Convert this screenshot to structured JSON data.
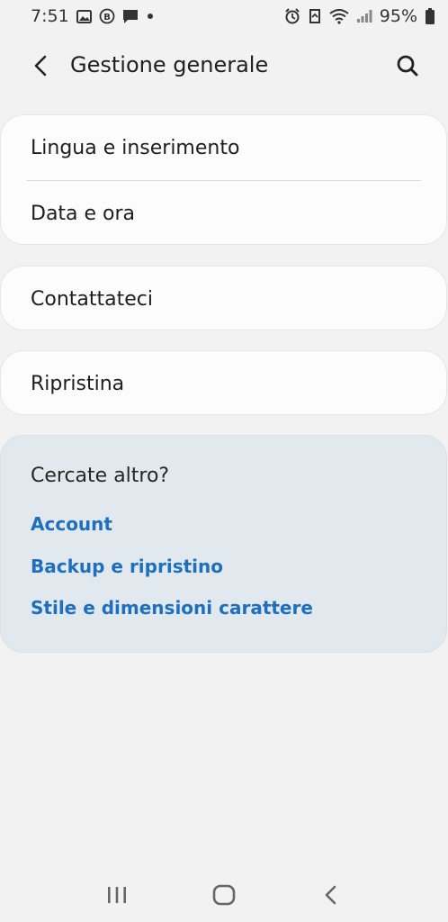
{
  "status_bar": {
    "time": "7:51",
    "battery": "95%",
    "left_icons": [
      "image-icon",
      "b-badge-icon",
      "message-icon",
      "dot-icon"
    ],
    "right_icons": [
      "alarm-icon",
      "sync-icon",
      "wifi-icon",
      "signal-icon",
      "battery-icon"
    ]
  },
  "app_bar": {
    "title": "Gestione generale"
  },
  "groups": [
    {
      "items": [
        "Lingua e inserimento",
        "Data e ora"
      ]
    },
    {
      "items": [
        "Contattateci"
      ]
    },
    {
      "items": [
        "Ripristina"
      ]
    }
  ],
  "suggestions": {
    "title": "Cercate altro?",
    "links": [
      "Account",
      "Backup e ripristino",
      "Stile e dimensioni carattere"
    ]
  },
  "colors": {
    "background": "#f2f2f2",
    "card": "#fcfcfc",
    "suggest_bg": "#e1e8ee",
    "link": "#1f6fbf"
  }
}
